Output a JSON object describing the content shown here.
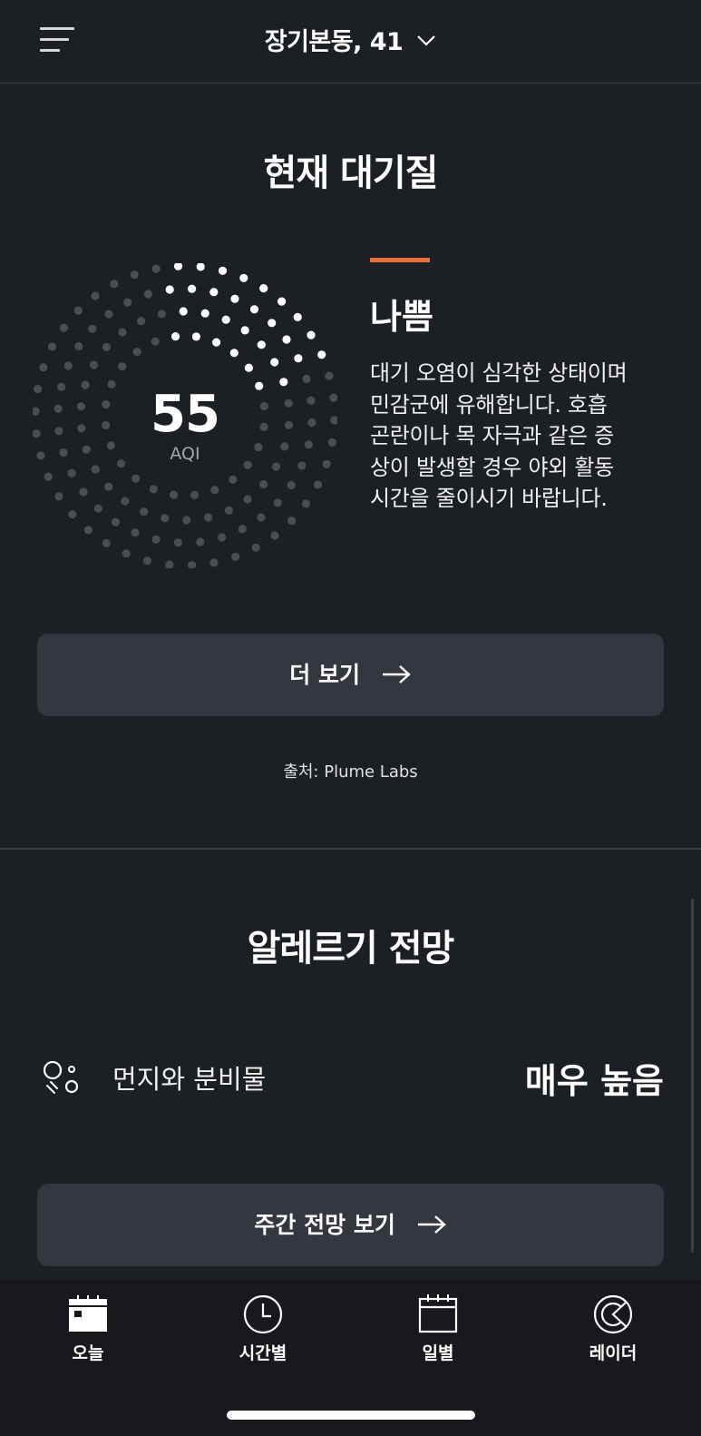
{
  "header": {
    "location": "장기본동, 41"
  },
  "air_quality": {
    "section_title": "현재 대기질",
    "aqi_value": "55",
    "aqi_unit": "AQI",
    "level_label": "나쁨",
    "level_color": "#e8703a",
    "description": "대기 오염이 심각한 상태이며 민감군에 유해합니다. 호흡 곤란이나 목 자극과 같은 증상이 발생할 경우 야외 활동 시간을 줄이시기 바랍니다.",
    "more_button": "더 보기",
    "source": "출처: Plume Labs",
    "ring_fill_fraction": 0.22
  },
  "allergy": {
    "section_title": "알레르기 전망",
    "items": [
      {
        "icon": "dust-dander-icon",
        "label": "먼지와 분비물",
        "value": "매우 높음"
      }
    ],
    "weekly_button": "주간 전망 보기"
  },
  "tabbar": {
    "tabs": [
      {
        "label": "오늘",
        "icon": "calendar-today-icon"
      },
      {
        "label": "시간별",
        "icon": "clock-icon"
      },
      {
        "label": "일별",
        "icon": "calendar-icon"
      },
      {
        "label": "레이더",
        "icon": "radar-icon"
      }
    ]
  }
}
